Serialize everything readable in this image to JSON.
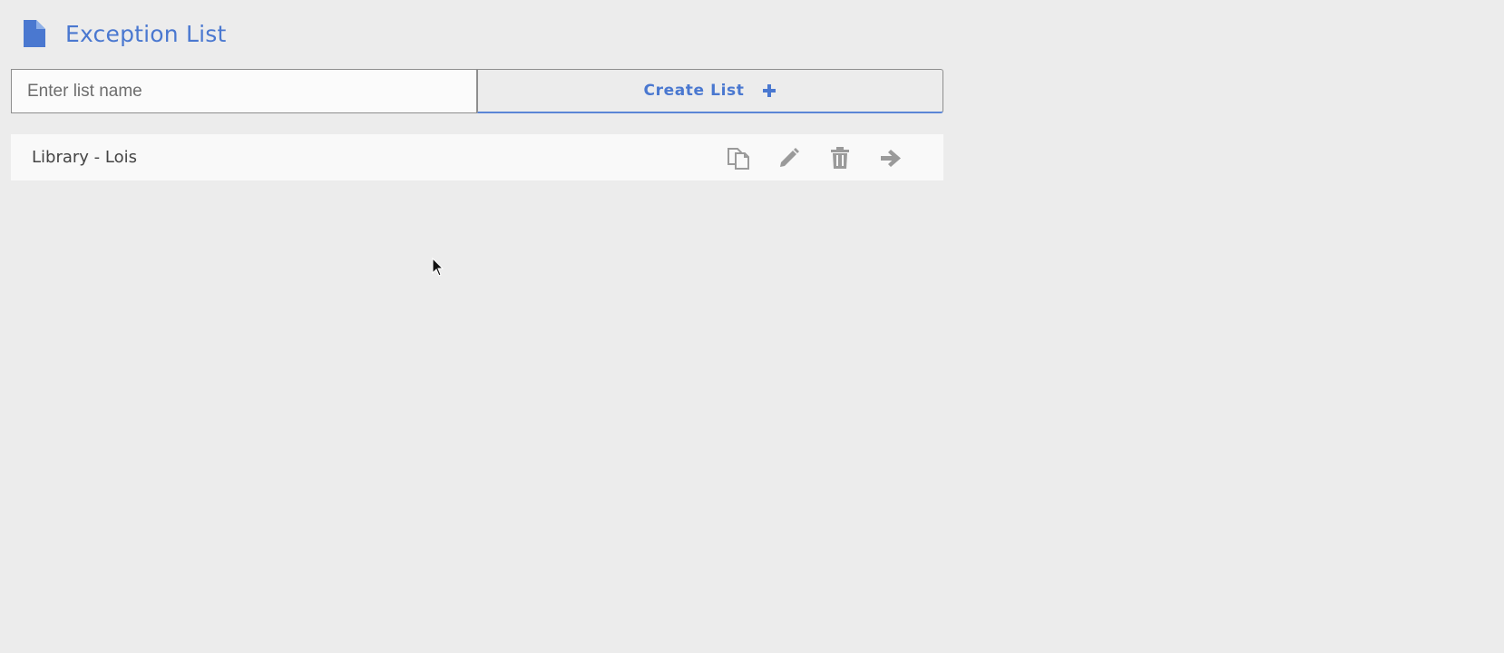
{
  "header": {
    "icon": "document-icon",
    "title": "Exception List"
  },
  "create_form": {
    "input_placeholder": "Enter list name",
    "input_value": "",
    "button_label": "Create List",
    "button_icon": "plus-icon"
  },
  "lists": [
    {
      "name": "Library - Lois",
      "actions": [
        "copy-icon",
        "edit-icon",
        "delete-icon",
        "open-arrow-icon"
      ]
    }
  ],
  "colors": {
    "accent": "#4a78d0",
    "icon_gray": "#999999",
    "background": "#ececec",
    "row_background": "#f9f9f9"
  }
}
